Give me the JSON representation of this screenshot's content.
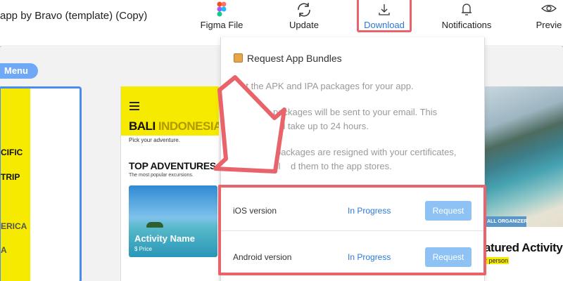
{
  "toolbar": {
    "app_title": "app by Bravo (template) (Copy)",
    "figma_file": "Figma File",
    "update": "Update",
    "download": "Download",
    "notifications": "Notifications",
    "preview": "Previe"
  },
  "canvas": {
    "menu_label": "Menu",
    "left_phone": {
      "labels": [
        "CIFIC",
        "TRIP",
        "ERICA",
        "A"
      ]
    },
    "mid_phone": {
      "title_a": "BALI",
      "title_b": "INDONESIA",
      "subtitle": "Pick your adventure.",
      "section_title": "TOP ADVENTURES",
      "section_sub": "The most popular excursions.",
      "activity_name": "Activity Name",
      "activity_price": "$ Price"
    },
    "right_phone": {
      "badge": "ALL ORGANIZER",
      "featured": "atured Activity",
      "per_person": "r person"
    }
  },
  "popup": {
    "title": "Request App Bundles",
    "para1": "Get the APK and IPA packages for your app.",
    "para2_line1": "packages will be sent to your email. This",
    "para2_line2": "uld take up to 24 hours.",
    "para3_line1": "Once        packages are resigned with your certificates,",
    "para3_line2": "you can upl    d them to the app stores.",
    "rows": [
      {
        "platform": "iOS version",
        "status": "In Progress",
        "action": "Request"
      },
      {
        "platform": "Android version",
        "status": "In Progress",
        "action": "Request"
      }
    ]
  },
  "colors": {
    "accent_blue": "#2b78d6",
    "highlight_red": "#e9636b",
    "brand_yellow": "#f6ea00",
    "request_button": "#8ec2f4"
  }
}
